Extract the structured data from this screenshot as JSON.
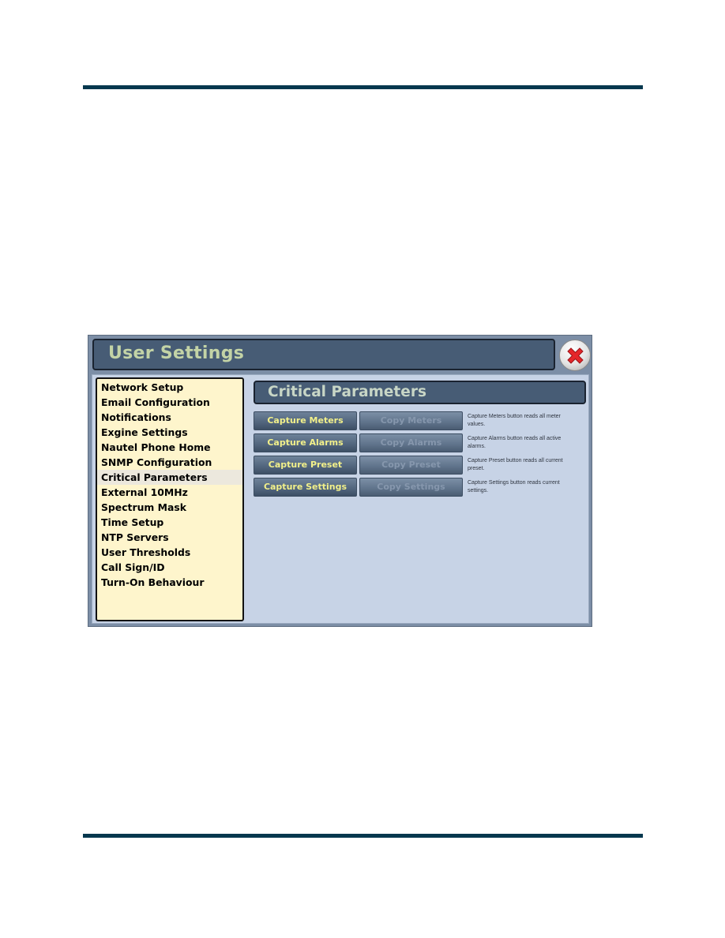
{
  "window": {
    "title": "User Settings",
    "close_icon": "close-x-icon"
  },
  "sidebar": {
    "selected_index": 6,
    "items": [
      {
        "label": "Network Setup"
      },
      {
        "label": "Email Configuration"
      },
      {
        "label": "Notifications"
      },
      {
        "label": "Exgine Settings"
      },
      {
        "label": "Nautel Phone Home"
      },
      {
        "label": "SNMP Configuration"
      },
      {
        "label": "Critical Parameters"
      },
      {
        "label": "External 10MHz"
      },
      {
        "label": "Spectrum Mask"
      },
      {
        "label": "Time Setup"
      },
      {
        "label": "NTP Servers"
      },
      {
        "label": "User Thresholds"
      },
      {
        "label": "Call Sign/ID"
      },
      {
        "label": "Turn-On Behaviour"
      }
    ]
  },
  "panel": {
    "title": "Critical Parameters",
    "rows": [
      {
        "capture_label": "Capture Meters",
        "copy_label": "Copy Meters",
        "copy_enabled": false,
        "description": "Capture Meters button reads all meter values."
      },
      {
        "capture_label": "Capture Alarms",
        "copy_label": "Copy Alarms",
        "copy_enabled": false,
        "description": "Capture Alarms button reads all active alarms."
      },
      {
        "capture_label": "Capture Preset",
        "copy_label": "Copy Preset",
        "copy_enabled": false,
        "description": "Capture Preset button reads all current preset."
      },
      {
        "capture_label": "Capture Settings",
        "copy_label": "Copy Settings",
        "copy_enabled": false,
        "description": "Capture Settings button reads current settings."
      }
    ]
  },
  "colors": {
    "page_rule": "#05384e",
    "title_bar": "#475c75",
    "title_text": "#c3d3a6",
    "sidebar_bg": "#fef5cc",
    "content_bg": "#c7d3e6",
    "capture_text": "#f2f08a"
  }
}
